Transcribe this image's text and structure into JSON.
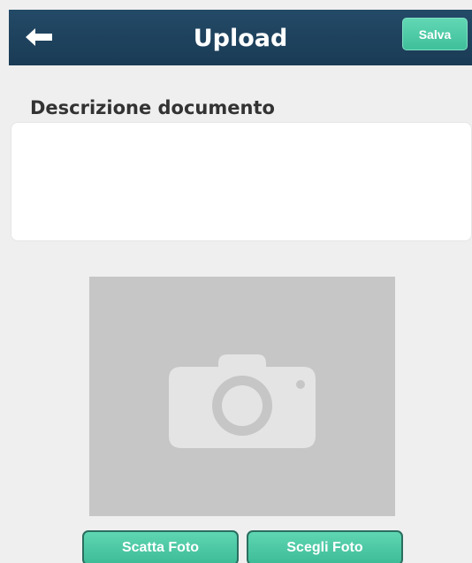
{
  "header": {
    "title": "Upload",
    "back_icon": "arrow-left-icon",
    "save_label": "Salva"
  },
  "form": {
    "description_label": "Descrizione documento",
    "description_value": "",
    "description_placeholder": ""
  },
  "photo": {
    "placeholder_icon": "camera-icon"
  },
  "actions": {
    "take_photo_label": "Scatta Foto",
    "choose_photo_label": "Scegli Foto"
  },
  "colors": {
    "header": "#1f4360",
    "accent": "#4cc8a4",
    "background": "#efefef",
    "placeholder": "#c6c6c6"
  }
}
